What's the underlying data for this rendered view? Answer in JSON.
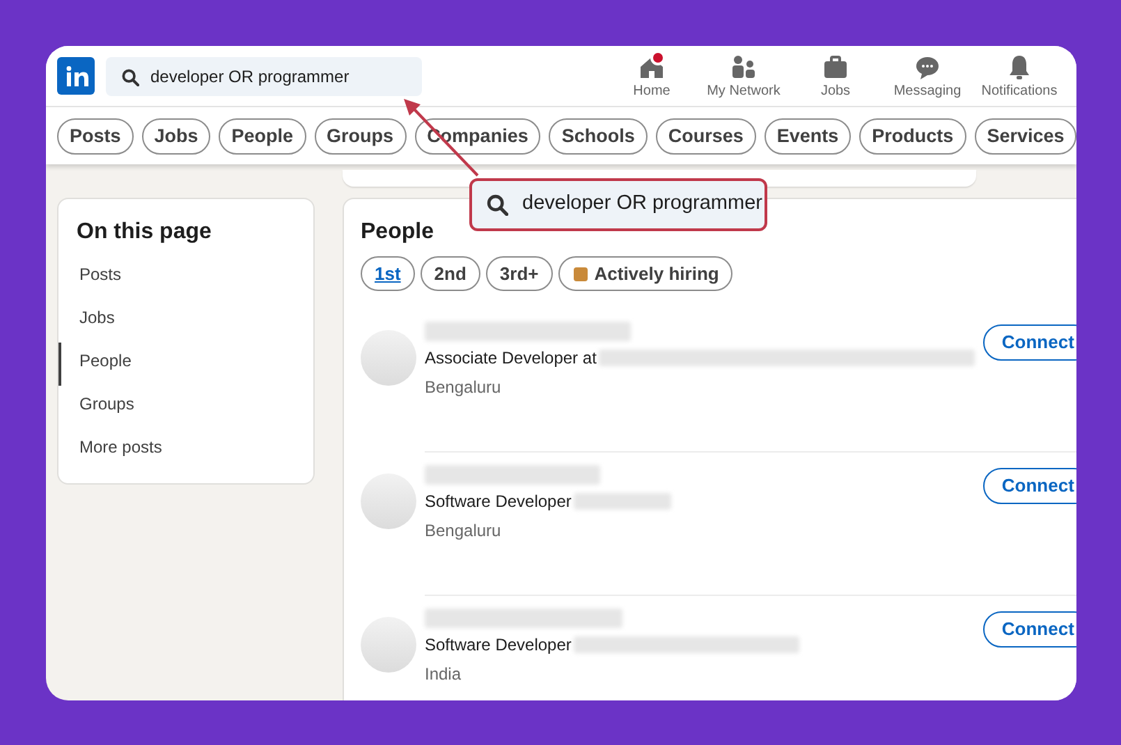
{
  "header": {
    "search": {
      "value": "developer OR programmer"
    },
    "nav": [
      {
        "kind": "home",
        "label": "Home",
        "badge": true
      },
      {
        "kind": "network",
        "label": "My Network",
        "badge": false
      },
      {
        "kind": "jobs",
        "label": "Jobs",
        "badge": false
      },
      {
        "kind": "messaging",
        "label": "Messaging",
        "badge": false
      },
      {
        "kind": "notifications",
        "label": "Notifications",
        "badge": false
      }
    ]
  },
  "filters": [
    {
      "label": "Posts"
    },
    {
      "label": "Jobs"
    },
    {
      "label": "People"
    },
    {
      "label": "Groups"
    },
    {
      "label": "Companies"
    },
    {
      "label": "Schools"
    },
    {
      "label": "Courses"
    },
    {
      "label": "Events"
    },
    {
      "label": "Products"
    },
    {
      "label": "Services"
    }
  ],
  "sidebar": {
    "title": "On this page",
    "items": [
      {
        "label": "Posts",
        "selected": false
      },
      {
        "label": "Jobs",
        "selected": false
      },
      {
        "label": "People",
        "selected": true
      },
      {
        "label": "Groups",
        "selected": false
      },
      {
        "label": "More posts",
        "selected": false
      }
    ]
  },
  "people": {
    "title": "People",
    "degree_filters": [
      {
        "label": "1st",
        "selected": true
      },
      {
        "label": "2nd",
        "selected": false
      },
      {
        "label": "3rd+",
        "selected": false
      }
    ],
    "hiring_filter": {
      "label": "Actively hiring"
    },
    "results": [
      {
        "headline": "Associate Developer at",
        "location": "Bengaluru",
        "action": "Connect"
      },
      {
        "headline": "Software Developer",
        "location": "Bengaluru",
        "action": "Connect"
      },
      {
        "headline": "Software Developer",
        "location": "India",
        "action": "Connect"
      }
    ]
  },
  "callout": {
    "text": "developer OR programmer"
  }
}
